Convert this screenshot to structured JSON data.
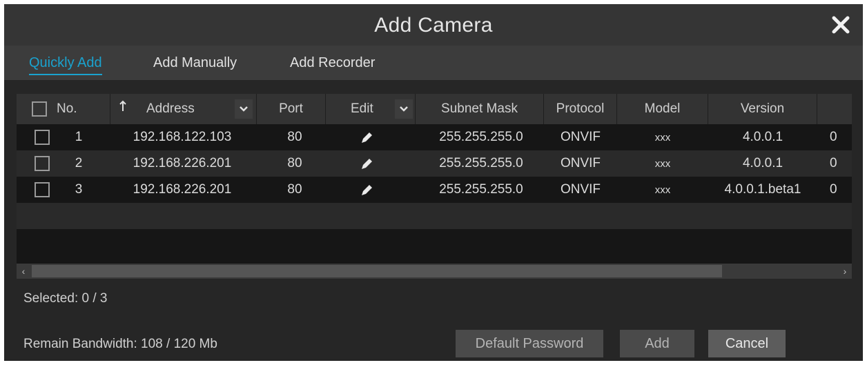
{
  "dialog": {
    "title": "Add Camera",
    "close_icon": "close-icon"
  },
  "tabs": [
    {
      "label": "Quickly Add",
      "active": true
    },
    {
      "label": "Add Manually",
      "active": false
    },
    {
      "label": "Add Recorder",
      "active": false
    }
  ],
  "table": {
    "columns": {
      "no": "No.",
      "address": "Address",
      "port": "Port",
      "edit": "Edit",
      "subnet": "Subnet Mask",
      "protocol": "Protocol",
      "model": "Model",
      "version": "Version"
    },
    "rows": [
      {
        "no": "1",
        "address": "192.168.122.103",
        "port": "80",
        "subnet": "255.255.255.0",
        "protocol": "ONVIF",
        "model": "xxx",
        "version": "4.0.0.1",
        "extra": "0"
      },
      {
        "no": "2",
        "address": "192.168.226.201",
        "port": "80",
        "subnet": "255.255.255.0",
        "protocol": "ONVIF",
        "model": "xxx",
        "version": "4.0.0.1",
        "extra": "0"
      },
      {
        "no": "3",
        "address": "192.168.226.201",
        "port": "80",
        "subnet": "255.255.255.0",
        "protocol": "ONVIF",
        "model": "xxx",
        "version": "4.0.0.1.beta1",
        "extra": "0"
      }
    ]
  },
  "status": {
    "selected": "Selected: 0 / 3",
    "bandwidth": "Remain Bandwidth: 108 / 120 Mb"
  },
  "buttons": {
    "default_password": "Default Password",
    "add": "Add",
    "cancel": "Cancel"
  },
  "colors": {
    "accent": "#1aa3cf",
    "background": "#262626"
  }
}
